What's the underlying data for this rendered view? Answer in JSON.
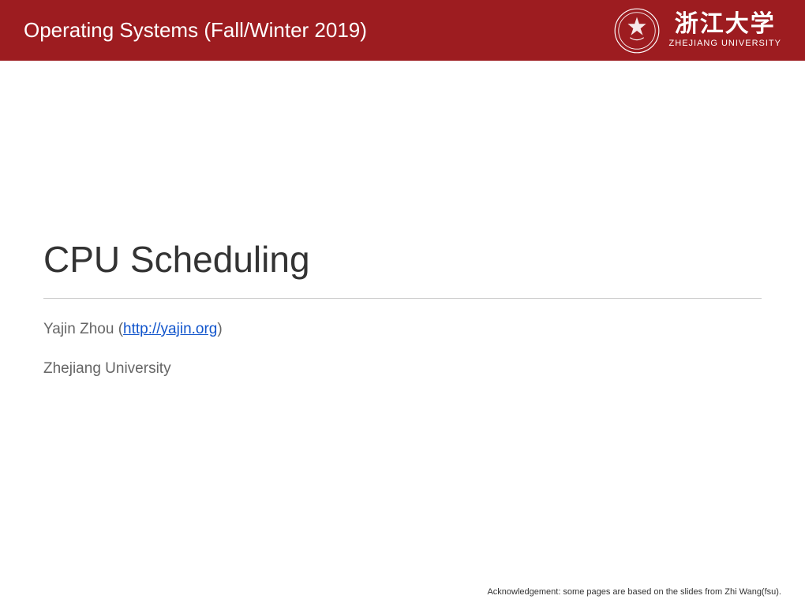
{
  "header": {
    "course_title": "Operating Systems (Fall/Winter 2019)",
    "logo": {
      "chinese_name": "浙江大学",
      "english_name": "ZHEJIANG UNIVERSITY"
    }
  },
  "slide": {
    "title": "CPU Scheduling",
    "author_prefix": "Yajin Zhou (",
    "author_link_text": "http://yajin.org",
    "author_suffix": ")",
    "university": "Zhejiang University"
  },
  "footer": {
    "acknowledgement": "Acknowledgement: some pages are based on the slides from Zhi Wang(fsu)."
  }
}
